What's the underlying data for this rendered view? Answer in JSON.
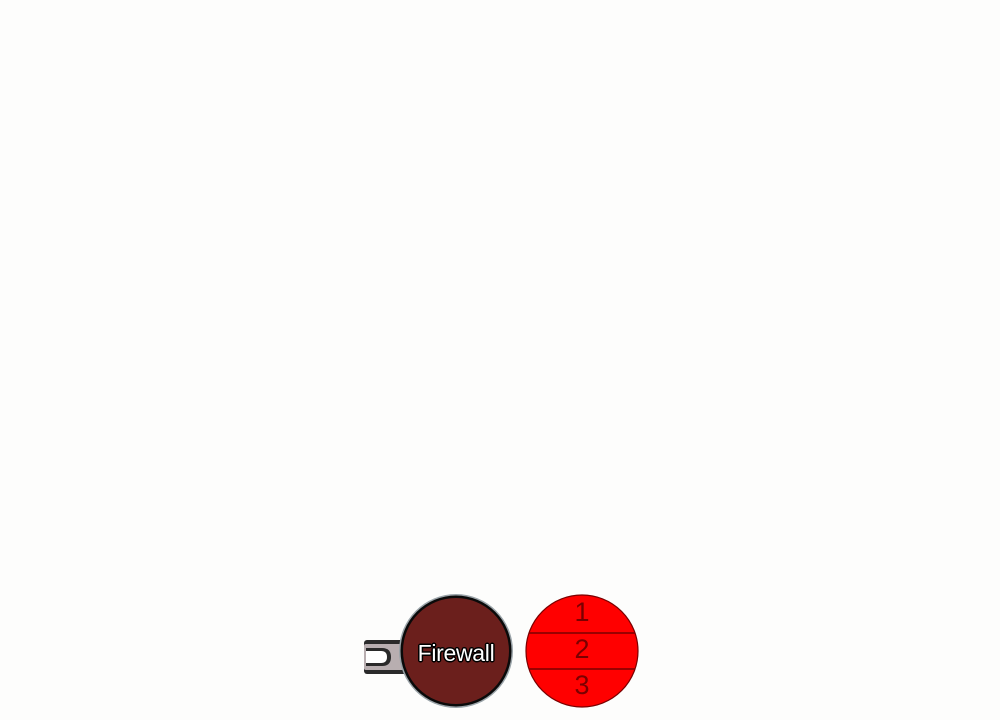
{
  "firewall": {
    "label": "Firewall",
    "fill_color": "#6b1f1c",
    "border_color": "#0a0a0a",
    "outer_ring_color": "#9aa3a8"
  },
  "connector": {
    "outer_color": "#2a2a2a",
    "inner_color": "#b8aeb0",
    "cap_color": "#ffffff"
  },
  "levels": {
    "fill_color": "#ff0000",
    "line_color": "#7a0000",
    "text_color": "#7a0000",
    "items": [
      {
        "label": "1"
      },
      {
        "label": "2"
      },
      {
        "label": "3"
      }
    ]
  }
}
